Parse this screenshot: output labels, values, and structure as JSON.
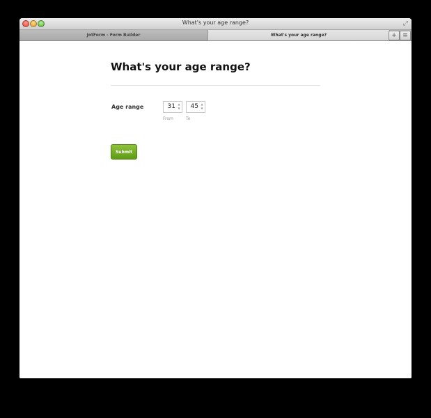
{
  "window": {
    "title": "What's your age range?"
  },
  "tabs": [
    {
      "label": "JotForm - Form Builder"
    },
    {
      "label": "What's your age range?"
    }
  ],
  "tab_controls": {
    "new_tab_glyph": "+",
    "menu_glyph": "≡"
  },
  "form": {
    "title": "What's your age range?",
    "field": {
      "label": "Age range",
      "from_value": "31",
      "to_value": "45",
      "from_sublabel": "From",
      "to_sublabel": "To"
    },
    "submit_label": "Submit"
  },
  "colors": {
    "submit_green": "#6fad1f"
  },
  "icons": [
    "close-icon",
    "minimize-icon",
    "maximize-icon",
    "fullscreen-icon",
    "spinner-up-icon",
    "spinner-down-icon"
  ]
}
